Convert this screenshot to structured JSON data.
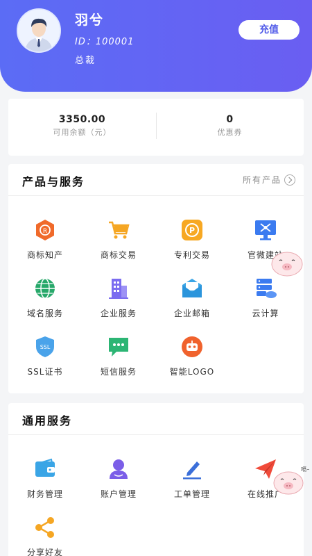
{
  "header": {
    "user_name": "羽兮",
    "user_id": "ID：100001",
    "user_role": "总裁",
    "recharge_label": "充值"
  },
  "balance": {
    "available_value": "3350.00",
    "available_label": "可用余额（元）",
    "coupon_value": "0",
    "coupon_label": "优惠券"
  },
  "products": {
    "title": "产品与服务",
    "more_label": "所有产品",
    "items": [
      {
        "label": "商标知产",
        "icon": "trademark-ip-icon"
      },
      {
        "label": "商标交易",
        "icon": "cart-icon"
      },
      {
        "label": "专利交易",
        "icon": "patent-icon"
      },
      {
        "label": "官微建站",
        "icon": "website-icon"
      },
      {
        "label": "域名服务",
        "icon": "globe-icon"
      },
      {
        "label": "企业服务",
        "icon": "building-icon"
      },
      {
        "label": "企业邮箱",
        "icon": "mail-icon"
      },
      {
        "label": "云计算",
        "icon": "cloud-server-icon"
      },
      {
        "label": "SSL证书",
        "icon": "ssl-shield-icon"
      },
      {
        "label": "短信服务",
        "icon": "sms-icon"
      },
      {
        "label": "智能LOGO",
        "icon": "robot-icon"
      }
    ]
  },
  "general": {
    "title": "通用服务",
    "items": [
      {
        "label": "财务管理",
        "icon": "wallet-icon"
      },
      {
        "label": "账户管理",
        "icon": "user-icon"
      },
      {
        "label": "工单管理",
        "icon": "edit-icon"
      },
      {
        "label": "在线推广",
        "icon": "paper-plane-icon"
      },
      {
        "label": "分享好友",
        "icon": "share-icon"
      }
    ]
  },
  "sticker_text": "嗝~",
  "colors": {
    "header_start": "#5b6cf5",
    "header_end": "#6a5ef2",
    "accent": "#4d57e8"
  }
}
